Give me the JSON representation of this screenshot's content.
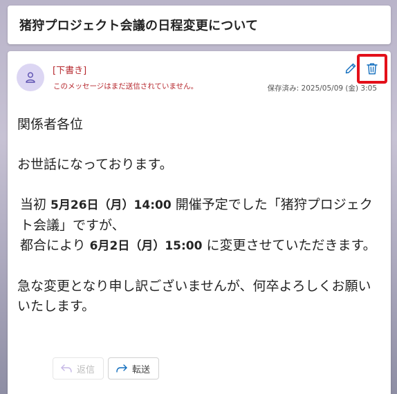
{
  "subject": "猪狩プロジェクト会議の日程変更について",
  "message": {
    "draft_tag": "[下書き]",
    "draft_note": "このメッセージはまだ送信されていません。",
    "saved_time": "保存済み: 2025/05/09 (金) 3:05",
    "icons": {
      "avatar": "person-icon",
      "edit": "pencil-icon",
      "delete": "trash-icon",
      "reply": "reply-arrow-icon",
      "forward": "forward-arrow-icon"
    },
    "colors": {
      "draft_red": "#b6282e",
      "highlight_border": "#e3101a",
      "accent_blue": "#0f6cbd",
      "avatar_bg": "#dcd6f3"
    },
    "body": {
      "greeting": "関係者各位",
      "intro": "お世話になっております。",
      "p1_a": "当初 ",
      "p1_date1": "5月26日（月）14:00",
      "p1_b": " 開催予定でした「猪狩プロジェクト会議」ですが、",
      "p1_c": "都合により ",
      "p1_date2": "6月2日（月）15:00",
      "p1_d": " に変更させていただきます。",
      "p2": "急な変更となり申し訳ございませんが、何卒よろしくお願いいたします。"
    },
    "actions": {
      "reply_label": "返信",
      "forward_label": "転送"
    }
  }
}
